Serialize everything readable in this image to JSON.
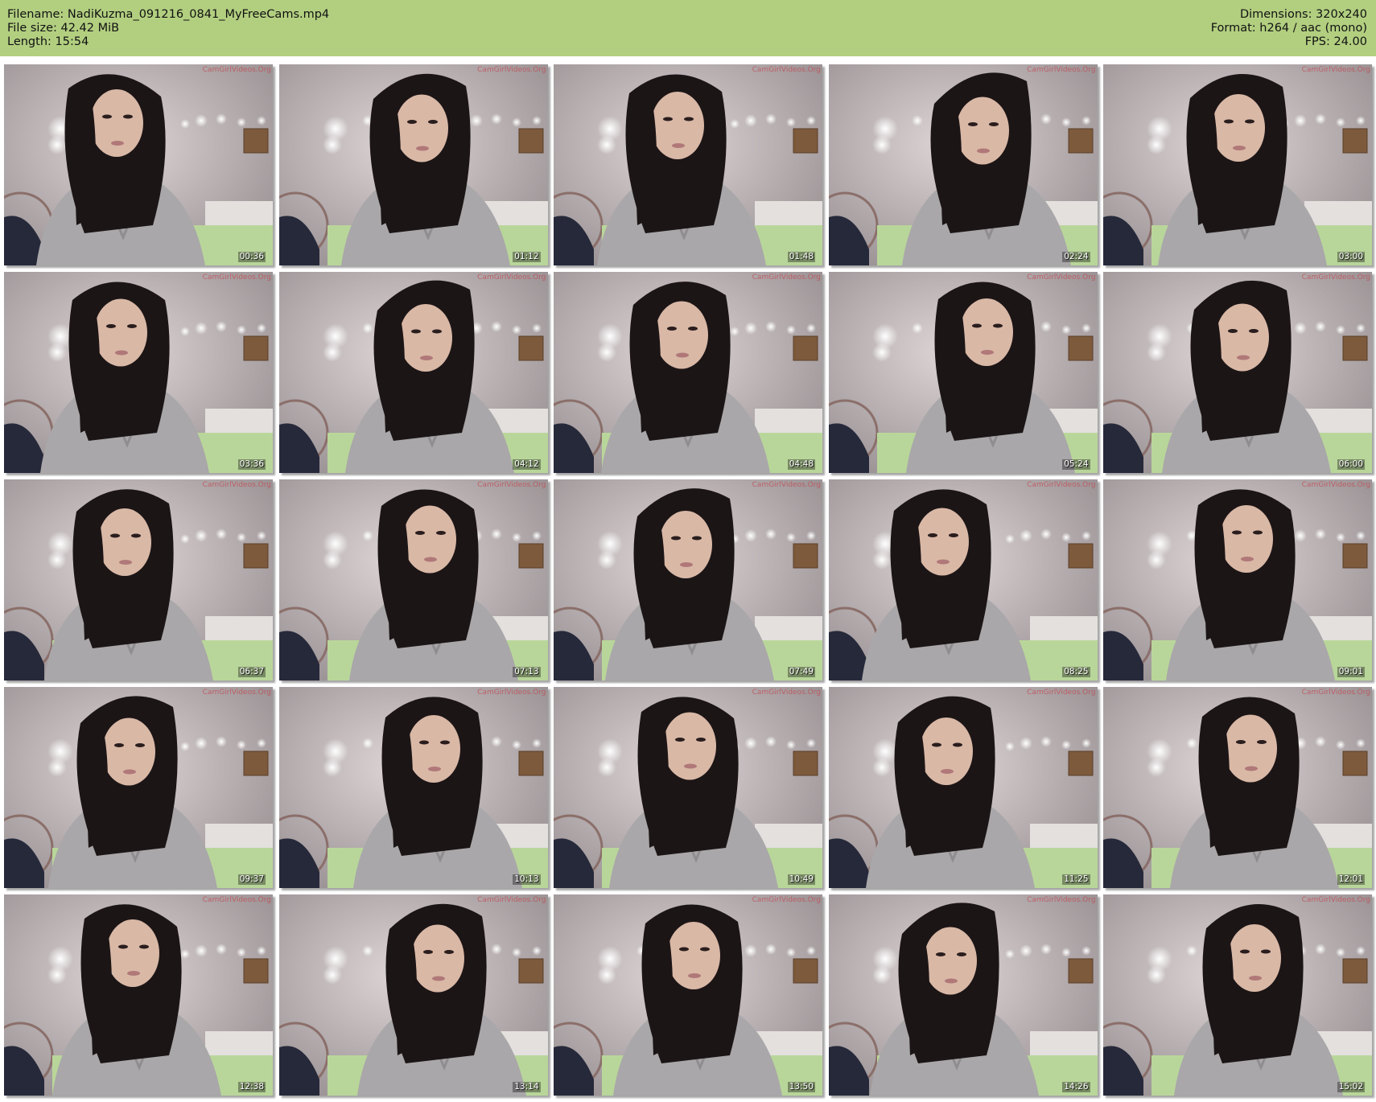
{
  "header": {
    "filename_line": "Filename: NadiKuzma_091216_0841_MyFreeCams.mp4",
    "filesize_line": "File size: 42.42 MiB",
    "length_line": "Length: 15:54",
    "dimensions_line": "Dimensions: 320x240",
    "format_line": "Format: h264 / aac (mono)",
    "fps_line": "FPS: 24.00"
  },
  "thumbnails": [
    {
      "time": "00:36"
    },
    {
      "time": "01:12"
    },
    {
      "time": "01:48"
    },
    {
      "time": "02:24"
    },
    {
      "time": "03:00"
    },
    {
      "time": "03:36"
    },
    {
      "time": "04:12"
    },
    {
      "time": "04:48"
    },
    {
      "time": "05:24"
    },
    {
      "time": "06:00"
    },
    {
      "time": "06:37"
    },
    {
      "time": "07:13"
    },
    {
      "time": "07:49"
    },
    {
      "time": "08:25"
    },
    {
      "time": "09:01"
    },
    {
      "time": "09:37"
    },
    {
      "time": "10:13"
    },
    {
      "time": "10:49"
    },
    {
      "time": "11:25"
    },
    {
      "time": "12:01"
    },
    {
      "time": "12:38"
    },
    {
      "time": "13:14"
    },
    {
      "time": "13:50"
    },
    {
      "time": "14:26"
    },
    {
      "time": "15:02"
    }
  ],
  "watermark": "CamGirlVideos.Org",
  "colors": {
    "header_bg": "#b2cf80",
    "wall": "#cbc2c4",
    "sweater": "#a9a7a9",
    "hair": "#1c1516",
    "bed": "#b9d69a"
  }
}
